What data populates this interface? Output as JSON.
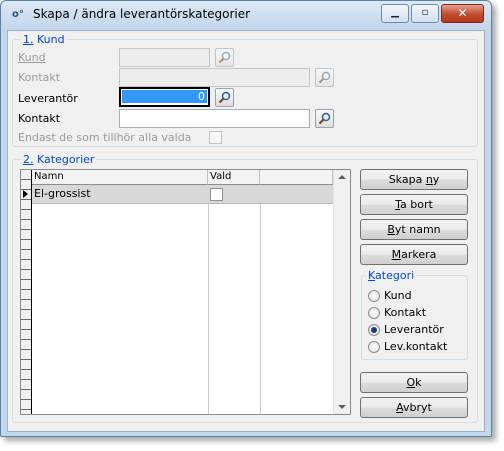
{
  "window": {
    "title": "Skapa / ändra leverantörskategorier",
    "minimize_glyph": "▁",
    "maximize_glyph": "▫",
    "close_glyph": "✕",
    "app_icon_glyph": "o°"
  },
  "kund_group": {
    "legend_number": "1.",
    "legend_text": " Kund",
    "kund_label": "Kund",
    "kontakt_label": "Kontakt",
    "leverantor_label": "Leverantör",
    "leverantor_value": "0",
    "leverantor_kontakt_label": "Kontakt",
    "leverantor_kontakt_value": "",
    "endast_label": "Endast de som tillhör alla valda"
  },
  "kategorier_group": {
    "legend_number": "2.",
    "legend_text": " Kategorier",
    "columns": [
      "Namn",
      "Vald"
    ],
    "rows": [
      {
        "namn": "El-grossist",
        "vald": false
      }
    ]
  },
  "buttons": {
    "skapa_pre": "Skapa ",
    "skapa_u": "n",
    "skapa_post": "y",
    "tabort_u": "T",
    "tabort_post": "a bort",
    "bytnamn_u": "B",
    "bytnamn_post": "yt namn",
    "markera_u": "M",
    "markera_post": "arkera",
    "ok_u": "O",
    "ok_post": "k",
    "avbryt_u": "A",
    "avbryt_post": "vbryt"
  },
  "kategori": {
    "legend_u": "K",
    "legend_post": "ategori",
    "options": [
      "Kund",
      "Kontakt",
      "Leverantör",
      "Lev.kontakt"
    ],
    "selected": "Leverantör"
  },
  "colors": {
    "legend_blue": "#0046d5",
    "selection_blue": "#3399ff",
    "close_red": "#c24b2c"
  }
}
